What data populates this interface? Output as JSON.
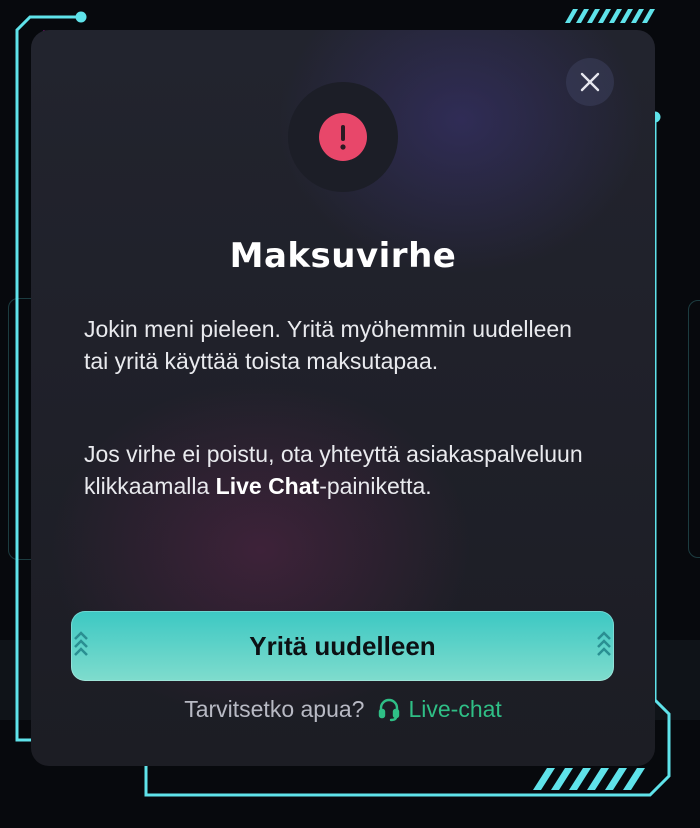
{
  "modal": {
    "title": "Maksuvirhe",
    "paragraph1": "Jokin meni pieleen. Yritä myöhemmin uudelleen tai yritä käyttää toista maksutapaa.",
    "paragraph2_before": "Jos virhe ei poistu, ota yhteyttä asiakaspalveluun klikkaamalla ",
    "paragraph2_bold": "Live Chat",
    "paragraph2_after": "-painiketta.",
    "retry_button_label": "Yritä uudelleen",
    "help_question": "Tarvitsetko apua?",
    "live_chat_label": "Live-chat",
    "alert_symbol": "!",
    "close_icon": "close-icon",
    "alert_icon": "alert-icon",
    "headset_icon": "headset-icon"
  },
  "colors": {
    "frame_accent": "#5fe3ea",
    "chevron_accent": "#e21dd8",
    "alert_red": "#e8476a",
    "button_teal": "#3cc8c3",
    "live_chat_green": "#2fbf86"
  }
}
